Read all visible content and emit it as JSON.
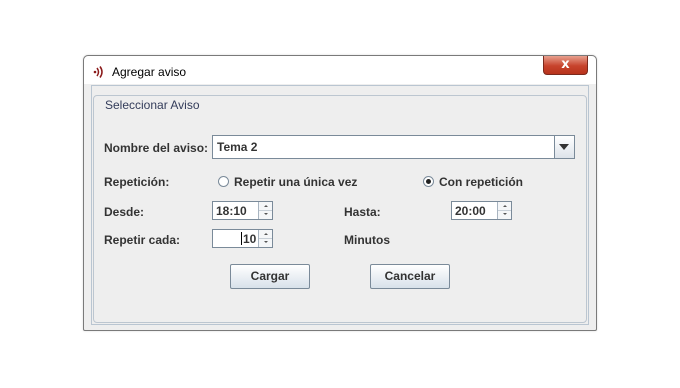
{
  "window": {
    "title": "Agregar aviso",
    "close_label": "x",
    "app_icon": "sound-waves-icon"
  },
  "group": {
    "title": "Seleccionar Aviso"
  },
  "form": {
    "nombre_label": "Nombre del aviso:",
    "nombre_value": "Tema 2",
    "repeticion_label": "Repetición:",
    "radio_unica_label": "Repetir una única vez",
    "radio_repeticion_label": "Con repetición",
    "selected_option": "Con repetición",
    "desde_label": "Desde:",
    "desde_value": "18:10",
    "hasta_label": "Hasta:",
    "hasta_value": "20:00",
    "repetir_label": "Repetir cada:",
    "repetir_value": "10",
    "minutos_label": "Minutos"
  },
  "buttons": {
    "cargar": "Cargar",
    "cancelar": "Cancelar"
  },
  "colors": {
    "close_button": "#c7432c",
    "dialog_bg": "#eeeeee",
    "border": "#7a8a99"
  }
}
